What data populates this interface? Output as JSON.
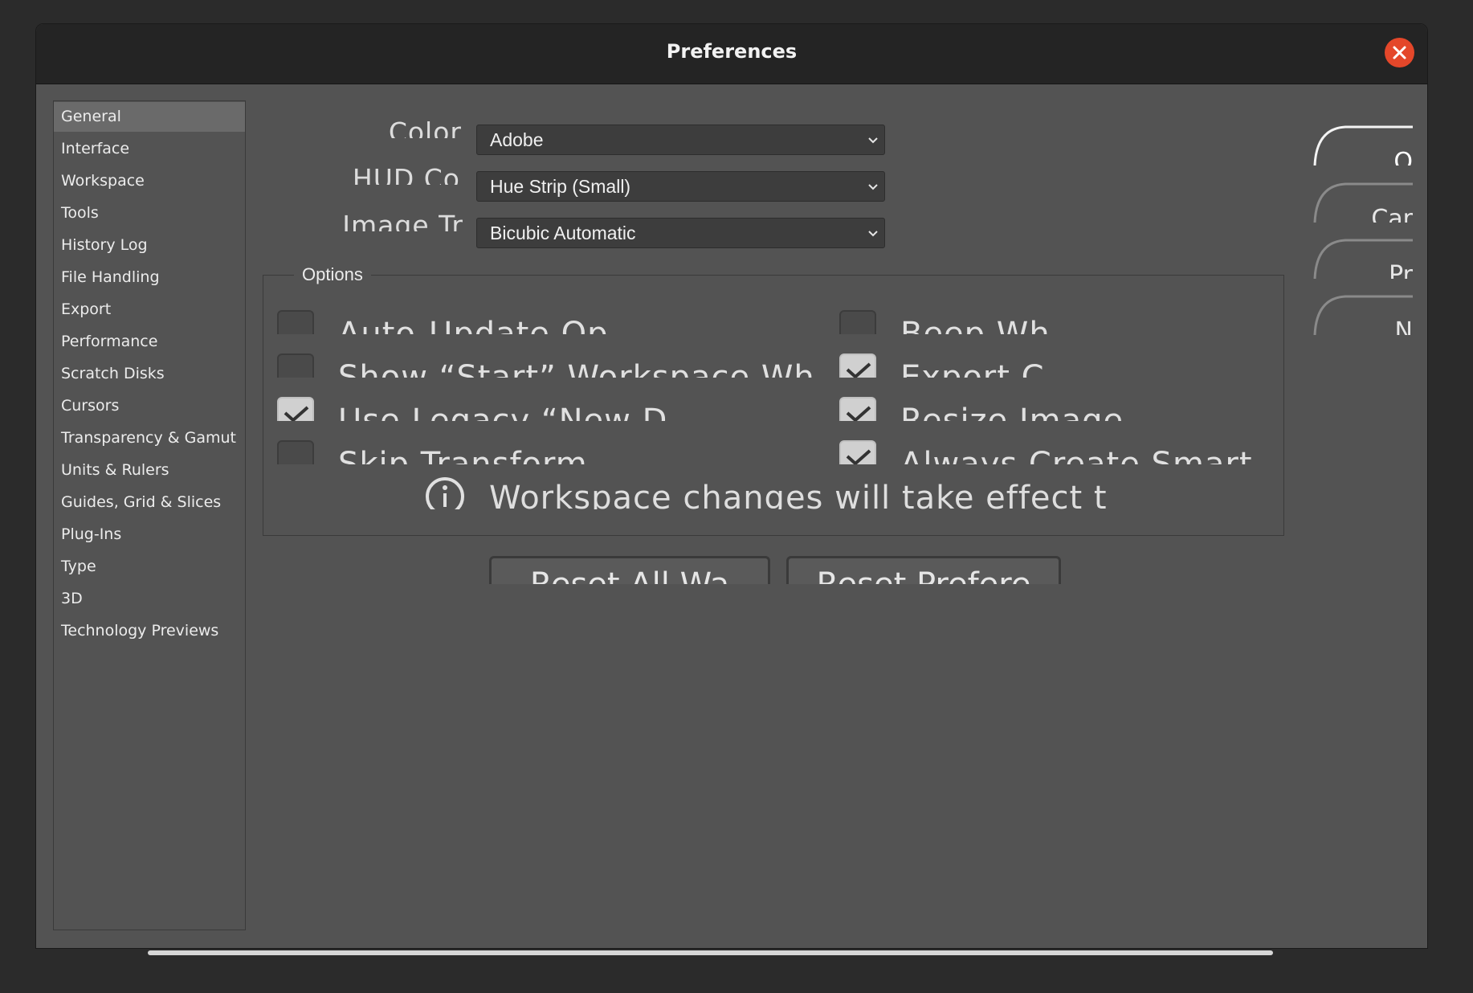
{
  "window": {
    "title": "Preferences"
  },
  "sidebar": {
    "items": [
      {
        "label": "General",
        "selected": true
      },
      {
        "label": "Interface"
      },
      {
        "label": "Workspace"
      },
      {
        "label": "Tools"
      },
      {
        "label": "History Log"
      },
      {
        "label": "File Handling"
      },
      {
        "label": "Export"
      },
      {
        "label": "Performance"
      },
      {
        "label": "Scratch Disks"
      },
      {
        "label": "Cursors"
      },
      {
        "label": "Transparency & Gamut"
      },
      {
        "label": "Units & Rulers"
      },
      {
        "label": "Guides, Grid & Slices"
      },
      {
        "label": "Plug-Ins"
      },
      {
        "label": "Type"
      },
      {
        "label": "3D"
      },
      {
        "label": "Technology Previews"
      }
    ]
  },
  "fields": {
    "color_picker": {
      "label": "Color",
      "value": "Adobe"
    },
    "hud_color_picker": {
      "label": "HUD Co",
      "value": "Hue Strip (Small)"
    },
    "image_interpolation": {
      "label": "Image Tr",
      "value": "Bicubic Automatic"
    }
  },
  "options": {
    "legend": "Options",
    "left": [
      {
        "label": "Auto-Update Op",
        "checked": false
      },
      {
        "label": "Show “Start” Workspace Wh",
        "checked": false
      },
      {
        "label": "Use Legacy “New D",
        "checked": true
      },
      {
        "label": "Skip Transform",
        "checked": false
      }
    ],
    "right": [
      {
        "label": "Beep Wh",
        "checked": false
      },
      {
        "label": "Export C",
        "checked": true
      },
      {
        "label": "Resize Image",
        "checked": true
      },
      {
        "label": "Always Create Smart C",
        "checked": true
      }
    ],
    "info_text": "Workspace changes will take effect th"
  },
  "buttons": {
    "reset_workspaces": "Reset All Wa",
    "reset_preferences": "Reset Prefere",
    "side": [
      "O",
      "Car",
      "Pr",
      "N"
    ]
  },
  "colors": {
    "accent_close": "#e4472a",
    "panel_bg": "#535353",
    "titlebar_bg": "#242424"
  }
}
